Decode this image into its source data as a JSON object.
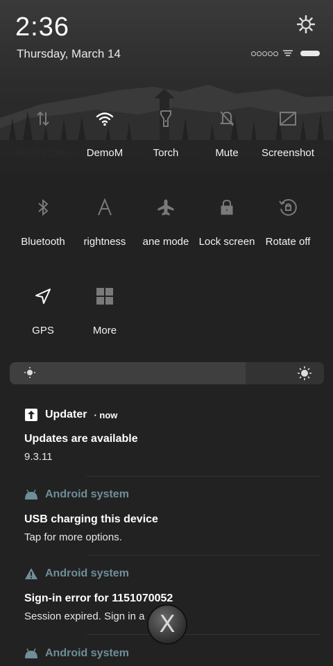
{
  "status": {
    "time": "2:36",
    "date": "Thursday, March 14"
  },
  "tiles_row1": [
    {
      "label": "Mobile data",
      "icon": "mobile-data-icon",
      "active": false
    },
    {
      "label": "DemoM",
      "icon": "wifi-icon",
      "active": true
    },
    {
      "label": "Torch",
      "icon": "torch-icon",
      "active": false
    },
    {
      "label": "Mute",
      "icon": "mute-icon",
      "active": false
    },
    {
      "label": "Screenshot",
      "icon": "screenshot-icon",
      "active": false
    }
  ],
  "tiles_row2": [
    {
      "label": "Bluetooth",
      "icon": "bluetooth-icon",
      "active": false
    },
    {
      "label": "rightness",
      "icon": "auto-brightness-icon",
      "active": false
    },
    {
      "label": "ane mode",
      "icon": "airplane-icon",
      "active": false
    },
    {
      "label": "Lock screen",
      "icon": "lock-icon",
      "active": false
    },
    {
      "label": "Rotate off",
      "icon": "rotate-icon",
      "active": false
    }
  ],
  "tiles_row3": [
    {
      "label": "GPS",
      "icon": "gps-icon",
      "active": true
    },
    {
      "label": "More",
      "icon": "more-grid-icon",
      "active": false
    }
  ],
  "brightness": {
    "level": 0.75
  },
  "notifications": [
    {
      "app": "Updater",
      "time": "now",
      "title": "Updates are available",
      "body": "9.3.11",
      "icon": "updater-icon"
    },
    {
      "app": "Android system",
      "title": "USB charging this device",
      "body": "Tap for more options.",
      "icon": "android-icon"
    },
    {
      "app": "Android system",
      "title": "Sign-in error for 1151070052",
      "body": "Session expired. Sign in a",
      "icon": "warning-icon"
    },
    {
      "app": "Android system",
      "icon": "android-icon"
    }
  ],
  "overlay": {
    "close_label": "X"
  }
}
